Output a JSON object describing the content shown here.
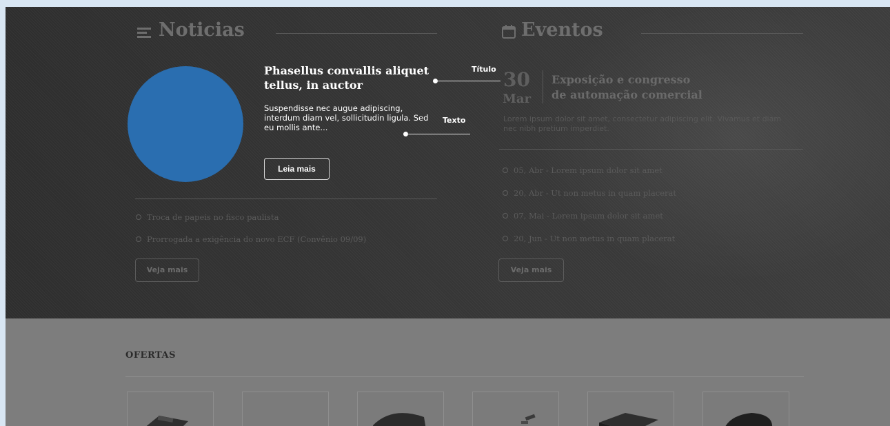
{
  "news": {
    "section_title": "Noticias",
    "headline": "Phasellus convallis aliquet tellus, in auctor",
    "body": "Suspendisse nec augue adipiscing, interdum diam vel, sollicitudin ligula. Sed eu mollis ante...",
    "read_more_label": "Leia mais",
    "annotation_title": "Título",
    "annotation_text": "Texto",
    "items": [
      "Troca de papeis no fisco paulista",
      "Prorrogada a exigência do novo ECF (Convênio 09/09)"
    ],
    "see_more_label": "Veja mais",
    "image_color": "#2a6eb0"
  },
  "events": {
    "section_title": "Eventos",
    "featured": {
      "day": "30",
      "month": "Mar",
      "title_line1": "Exposição e congresso",
      "title_line2": "de automação comercial",
      "text": "Lorem ipsum dolor sit amet, consectetur adipiscing elit. Vivamus et diam nec nibh pretium imperdiet."
    },
    "items": [
      "05, Abr - Lorem ipsum dolor sit amet",
      "20, Abr - Ut non metus in quam placerat",
      "07, Mai - Lorem ipsum dolor sit amet",
      "20, Jun - Ut non metus in quam placerat"
    ],
    "see_more_label": "Veja mais"
  },
  "offers": {
    "title": "OFERTAS",
    "products": [
      "product-1",
      "product-2",
      "product-3",
      "product-4",
      "product-5",
      "product-6"
    ]
  },
  "icons": {
    "news": "list-lines-icon",
    "events": "calendar-icon"
  }
}
